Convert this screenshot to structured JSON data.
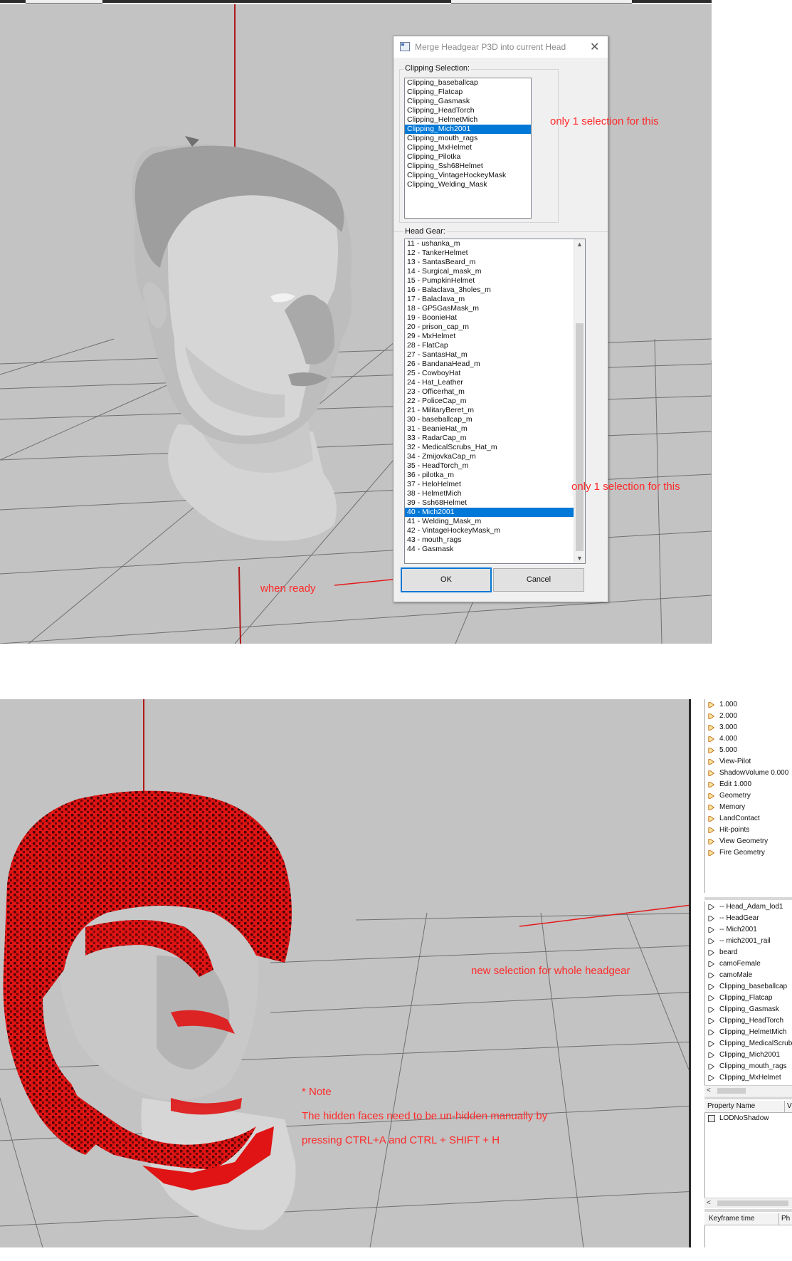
{
  "dialog": {
    "title": "Merge Headgear P3D into current Head",
    "close_glyph": "✕",
    "clipping_label": "Clipping Selection:",
    "clipping_items": [
      "Clipping_baseballcap",
      "Clipping_Flatcap",
      "Clipping_Gasmask",
      "Clipping_HeadTorch",
      "Clipping_HelmetMich",
      "Clipping_Mich2001",
      "Clipping_mouth_rags",
      "Clipping_MxHelmet",
      "Clipping_Pilotka",
      "Clipping_Ssh68Helmet",
      "Clipping_VintageHockeyMask",
      "Clipping_Welding_Mask"
    ],
    "clipping_selected": "Clipping_Mich2001",
    "headgear_label": "Head Gear:",
    "headgear_items": [
      "11 - ushanka_m",
      "12 - TankerHelmet",
      "13 - SantasBeard_m",
      "14 - Surgical_mask_m",
      "15 - PumpkinHelmet",
      "16 - Balaclava_3holes_m",
      "17 - Balaclava_m",
      "18 - GP5GasMask_m",
      "19 - BoonieHat",
      "20 - prison_cap_m",
      "29 - MxHelmet",
      "28 - FlatCap",
      "27 - SantasHat_m",
      "26 - BandanaHead_m",
      "25 - CowboyHat",
      "24 - Hat_Leather",
      "23 - Officerhat_m",
      "22 - PoliceCap_m",
      "21 - MilitaryBeret_m",
      "30 - baseballcap_m",
      "31 - BeanieHat_m",
      "33 - RadarCap_m",
      "32 - MedicalScrubs_Hat_m",
      "34 - ZmijovkaCap_m",
      "35 - HeadTorch_m",
      "36 - pilotka_m",
      "37 - HeloHelmet",
      "38 - HelmetMich",
      "39 - Ssh68Helmet",
      "40 - Mich2001",
      "41 - Welding_Mask_m",
      "42 - VintageHockeyMask_m",
      "43 - mouth_rags",
      "44 - Gasmask"
    ],
    "headgear_selected": "40 - Mich2001",
    "ok_label": "OK",
    "cancel_label": "Cancel",
    "scroll_up_glyph": "▲",
    "scroll_down_glyph": "▼"
  },
  "annotations": {
    "clipping_note": "only 1 selection for this",
    "headgear_note": "only 1 selection for this",
    "ok_note": "when ready",
    "selection_note": "new selection for whole headgear",
    "note_title": "* Note",
    "note_line1": "The hidden faces need to be un-hidden manually by",
    "note_line2": "pressing CTRL+A and CTRL + SHIFT + H"
  },
  "right_panel": {
    "lods": [
      "1.000",
      "2.000",
      "3.000",
      "4.000",
      "5.000",
      "View-Pilot",
      "ShadowVolume 0.000",
      "Edit 1.000",
      "Geometry",
      "Memory",
      "LandContact",
      "Hit-points",
      "View Geometry",
      "Fire Geometry"
    ],
    "selections": [
      "-- Head_Adam_lod1",
      "-- HeadGear",
      "-- Mich2001",
      "-- mich2001_rail",
      "beard",
      "camoFemale",
      "camoMale",
      "Clipping_baseballcap",
      "Clipping_Flatcap",
      "Clipping_Gasmask",
      "Clipping_HeadTorch",
      "Clipping_HelmetMich",
      "Clipping_MedicalScrub",
      "Clipping_Mich2001",
      "Clipping_mouth_rags",
      "Clipping_MxHelmet"
    ],
    "property_header": "Property Name",
    "property_header_extra": "V",
    "property_item": "LODNoShadow",
    "keyframe_header": "Keyframe time",
    "keyframe_header_extra": "Ph",
    "scroll_left_glyph": "<"
  },
  "colors": {
    "viewport_bg": "#c3c3c3",
    "grid_line": "#6e6e6e",
    "axis_red": "#b01818",
    "annotation_red": "#ff2a2a",
    "selection_blue": "#0078d7",
    "helmet_red": "#e01414"
  },
  "icons": {
    "dialog_app": "window-icon",
    "close": "close-icon",
    "lod_item": "lod-arrow-icon",
    "selection_item": "selection-arrow-icon",
    "property_item": "property-icon"
  }
}
